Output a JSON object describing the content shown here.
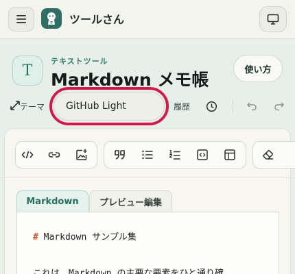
{
  "app": {
    "name": "ツールさん",
    "menu_icon": "hamburger-icon",
    "logo_icon": "mascot-logo",
    "display_icon": "monitor-icon"
  },
  "tool": {
    "category": "テキストツール",
    "icon_letter": "T",
    "title": "Markdown メモ帳",
    "usage_button": "使い方"
  },
  "controls": {
    "theme_label": "テーマ",
    "theme_value": "GitHub Light",
    "history_label": "履歴",
    "icons": [
      "expand-icon",
      "clock-icon",
      "undo-icon",
      "redo-icon"
    ]
  },
  "toolbar": {
    "groups": [
      [
        "code-icon",
        "link-icon",
        "image-add-icon"
      ],
      [
        "quote-icon",
        "bullet-list-icon",
        "numbered-list-icon",
        "code-block-icon",
        "table-icon"
      ],
      [
        "eraser-icon"
      ]
    ]
  },
  "tabs": [
    {
      "label": "Markdown",
      "active": true
    },
    {
      "label": "プレビュー編集",
      "active": false
    }
  ],
  "editor": {
    "line1_hash": "#",
    "line1_text": " Markdown サンプル集",
    "line3_text": "これは、Markdown の主要な要素をひと通り確"
  },
  "colors": {
    "accent": "#2f6e62",
    "highlight": "#cf1a4a",
    "background": "#e7efea"
  }
}
